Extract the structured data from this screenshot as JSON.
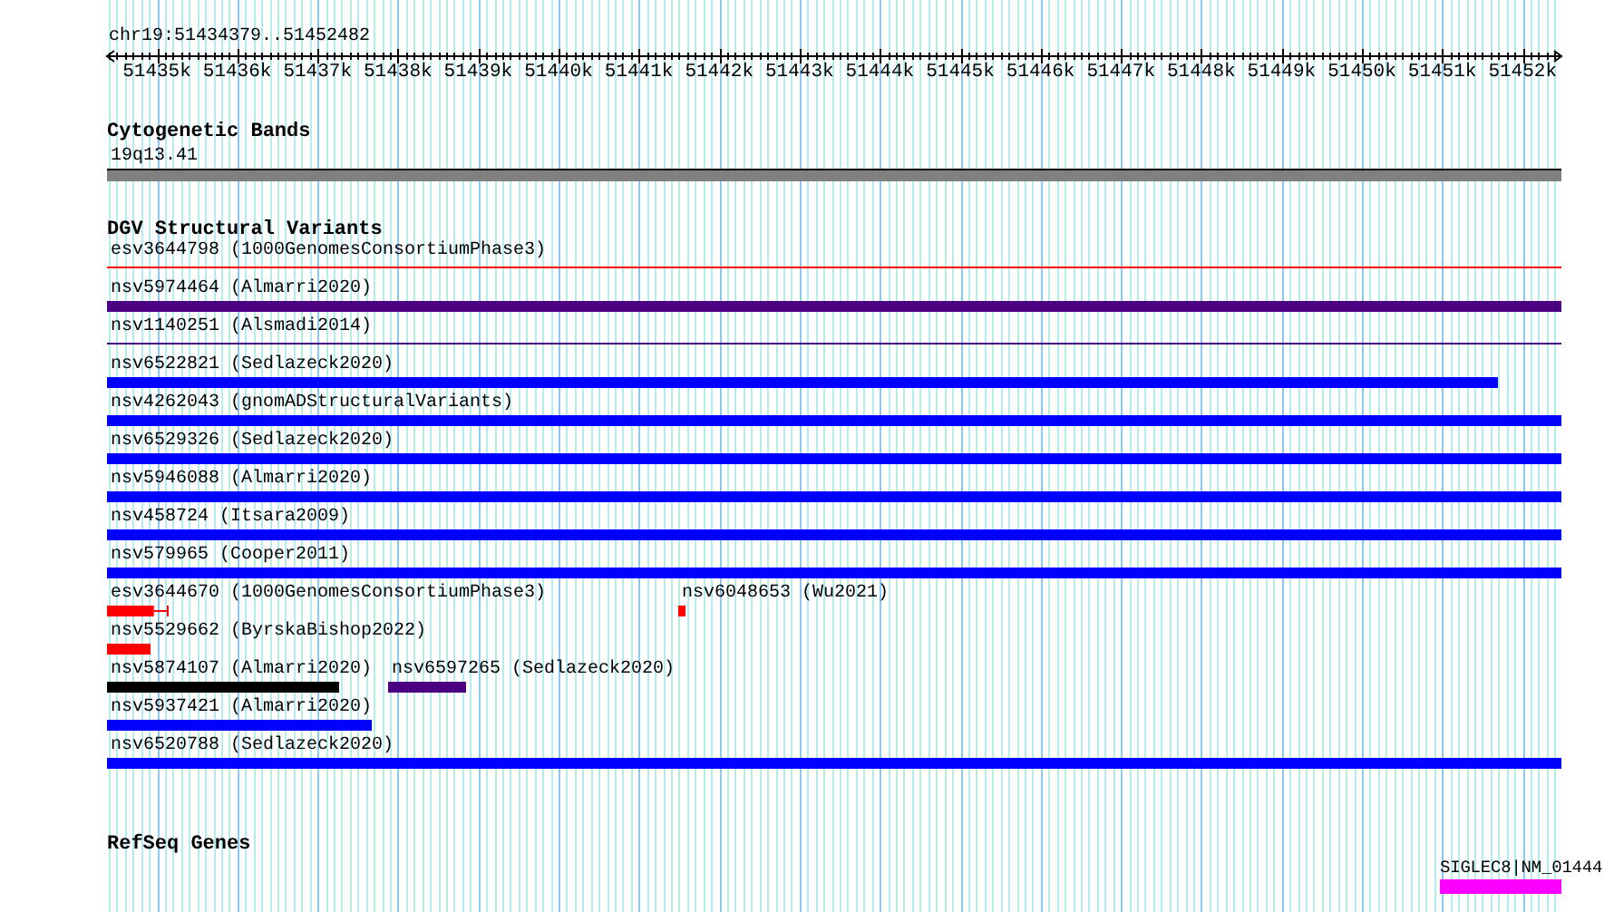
{
  "ruler": {
    "location": "chr19:51434379..51452482",
    "ticks": [
      "51435k",
      "51436k",
      "51437k",
      "51438k",
      "51439k",
      "51440k",
      "51441k",
      "51442k",
      "51443k",
      "51444k",
      "51445k",
      "51446k",
      "51447k",
      "51448k",
      "51449k",
      "51450k",
      "51451k",
      "51452k"
    ]
  },
  "tracks": [
    {
      "title": "Cytogenetic Bands",
      "lanes": [
        [
          {
            "label": "19q13.41",
            "kind": "band",
            "color": "#808080"
          }
        ]
      ]
    },
    {
      "title": "DGV Structural Variants",
      "lanes": [
        [
          {
            "label": "esv3644798 (1000GenomesConsortiumPhase3)",
            "kind": "line",
            "color": "#ff0000"
          }
        ],
        [
          {
            "label": "nsv5974464 (Almarri2020)",
            "kind": "bar",
            "color": "#4b0082"
          }
        ],
        [
          {
            "label": "nsv1140251 (Alsmadi2014)",
            "kind": "line",
            "color": "#4b0082"
          }
        ],
        [
          {
            "label": "nsv6522821 (Sedlazeck2020)",
            "kind": "bar",
            "color": "#0000ff"
          }
        ],
        [
          {
            "label": "nsv4262043 (gnomADStructuralVariants)",
            "kind": "bar",
            "color": "#0000ff"
          }
        ],
        [
          {
            "label": "nsv6529326 (Sedlazeck2020)",
            "kind": "bar",
            "color": "#0000ff"
          }
        ],
        [
          {
            "label": "nsv5946088 (Almarri2020)",
            "kind": "bar",
            "color": "#0000ff"
          }
        ],
        [
          {
            "label": "nsv458724 (Itsara2009)",
            "kind": "bar",
            "color": "#0000ff"
          }
        ],
        [
          {
            "label": "nsv579965 (Cooper2011)",
            "kind": "bar",
            "color": "#0000ff"
          }
        ],
        [
          {
            "label": "esv3644670 (1000GenomesConsortiumPhase3)",
            "kind": "whisker",
            "color": "#ff0000"
          },
          {
            "label": "nsv6048653 (Wu2021)",
            "kind": "bar",
            "color": "#ff0000"
          }
        ],
        [
          {
            "label": "nsv5529662 (ByrskaBishop2022)",
            "kind": "bar",
            "color": "#ff0000"
          }
        ],
        [
          {
            "label": "nsv5874107 (Almarri2020)",
            "kind": "bar",
            "color": "#000000"
          },
          {
            "label": "nsv6597265 (Sedlazeck2020)",
            "kind": "bar",
            "color": "#4b0082"
          }
        ],
        [
          {
            "label": "nsv5937421 (Almarri2020)",
            "kind": "bar",
            "color": "#0000ff"
          }
        ],
        [
          {
            "label": "nsv6520788 (Sedlazeck2020)",
            "kind": "bar",
            "color": "#0000ff"
          }
        ]
      ]
    },
    {
      "title": "RefSeq Genes",
      "lanes": [
        [
          {
            "label": "SIGLEC8|NM_01444",
            "kind": "gene",
            "color": "#ff00ff"
          }
        ]
      ]
    }
  ]
}
